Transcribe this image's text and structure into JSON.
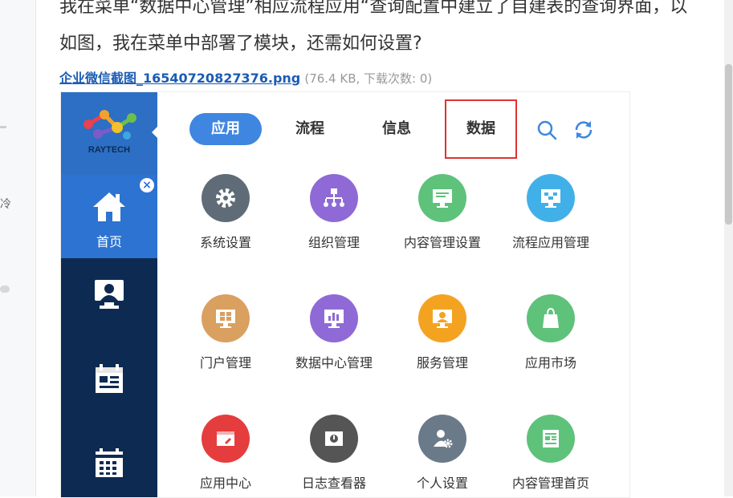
{
  "question": {
    "line1": "我在菜单“数据中心管理”相应流程应用“查询配置中建立了自建表的查询界面，以",
    "line2": "如图，我在菜单中部署了模块，还需如何设置?"
  },
  "attachment": {
    "filename": "企业微信截图_16540720827376.png",
    "meta": "(76.4 KB, 下载次数: 0)"
  },
  "gutter_text": "冷",
  "app": {
    "logo_text": "RAYTECH",
    "home_label": "首页",
    "close_glyph": "×",
    "tabs": [
      {
        "label": "应用",
        "active": true
      },
      {
        "label": "流程",
        "active": false
      },
      {
        "label": "信息",
        "active": false
      },
      {
        "label": "数据",
        "active": false,
        "highlighted": true
      }
    ],
    "apps": [
      {
        "label": "系统设置",
        "color": "#5f6c77",
        "icon": "gear-icon"
      },
      {
        "label": "组织管理",
        "color": "#8f6ad6",
        "icon": "org-chart-icon"
      },
      {
        "label": "内容管理设置",
        "color": "#5ec27a",
        "icon": "monitor-icon"
      },
      {
        "label": "流程应用管理",
        "color": "#42b0e8",
        "icon": "flow-monitor-icon"
      },
      {
        "label": "门户管理",
        "color": "#d9a060",
        "icon": "portal-icon"
      },
      {
        "label": "数据中心管理",
        "color": "#8f6ad6",
        "icon": "chart-monitor-icon"
      },
      {
        "label": "服务管理",
        "color": "#f4a321",
        "icon": "service-icon"
      },
      {
        "label": "应用市场",
        "color": "#5ec27a",
        "icon": "shopping-bag-icon"
      },
      {
        "label": "应用中心",
        "color": "#e53d3d",
        "icon": "app-window-icon"
      },
      {
        "label": "日志查看器",
        "color": "#555555",
        "icon": "log-icon"
      },
      {
        "label": "个人设置",
        "color": "#6b7a88",
        "icon": "user-gear-icon"
      },
      {
        "label": "内容管理首页",
        "color": "#5ec27a",
        "icon": "document-icon"
      }
    ]
  }
}
